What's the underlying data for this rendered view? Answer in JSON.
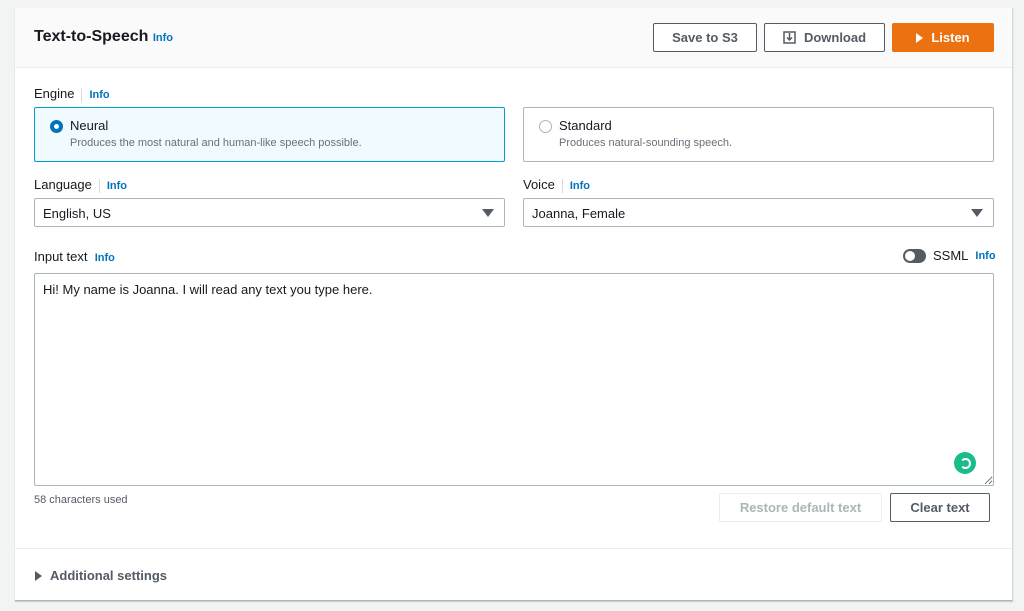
{
  "header": {
    "title": "Text-to-Speech",
    "info": "Info",
    "save_s3": "Save to S3",
    "download": "Download",
    "listen": "Listen"
  },
  "engine": {
    "label": "Engine",
    "info": "Info",
    "options": [
      {
        "name": "Neural",
        "desc": "Produces the most natural and human-like speech possible.",
        "selected": true
      },
      {
        "name": "Standard",
        "desc": "Produces natural-sounding speech.",
        "selected": false
      }
    ]
  },
  "language": {
    "label": "Language",
    "info": "Info",
    "value": "English, US"
  },
  "voice": {
    "label": "Voice",
    "info": "Info",
    "value": "Joanna, Female"
  },
  "input": {
    "label": "Input text",
    "info": "Info",
    "ssml_label": "SSML",
    "ssml_info": "Info",
    "ssml_on": false,
    "value": "Hi! My name is Joanna. I will read any text you type here.",
    "chars_used": "58 characters used",
    "restore": "Restore default text",
    "clear": "Clear text"
  },
  "additional": {
    "label": "Additional settings"
  },
  "colors": {
    "accent": "#ec7211",
    "link": "#0073bb",
    "assistant_badge": "#1abc8c"
  }
}
